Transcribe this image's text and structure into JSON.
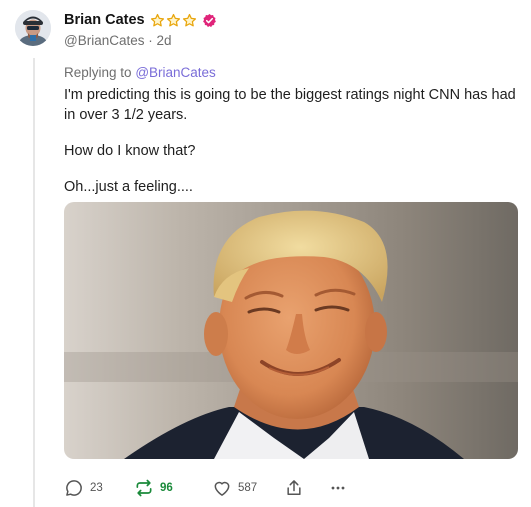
{
  "post": {
    "author": {
      "display_name": "Brian Cates",
      "handle": "@BrianCates",
      "time_ago": "2d",
      "star_count": 3,
      "badge_color": "#e0247a"
    },
    "reply": {
      "prefix": "Replying to",
      "mention": "@BrianCates"
    },
    "paragraphs": [
      "I'm predicting this is going to be the biggest ratings night CNN has had in over 3 1/2 years.",
      "How do I know that?",
      "Oh...just a feeling...."
    ],
    "actions": {
      "replies": "23",
      "restacks": "96",
      "likes": "587"
    }
  },
  "colors": {
    "accent": "#7a6dd8",
    "restack_green": "#1a8a3a",
    "star_gold": "#e8a50c",
    "muted_text": "#6e6e6e"
  }
}
